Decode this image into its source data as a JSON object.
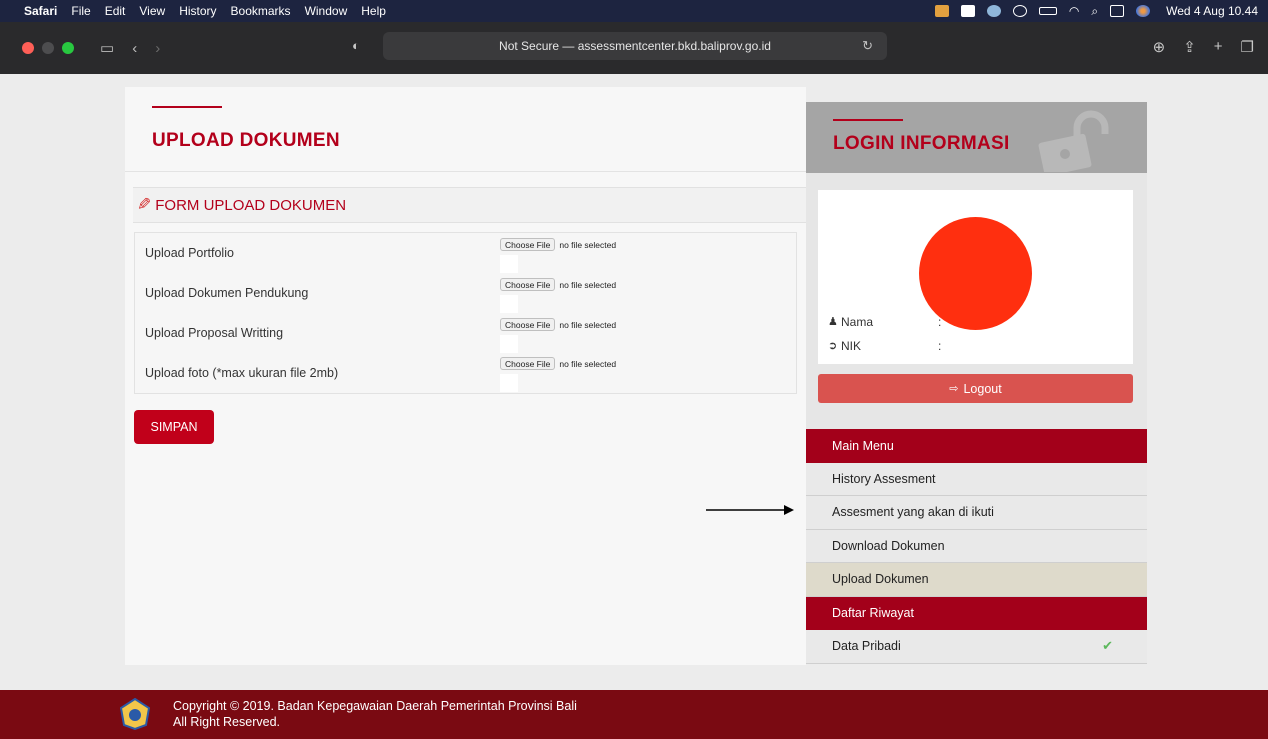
{
  "menubar": {
    "app": "Safari",
    "items": [
      "File",
      "Edit",
      "View",
      "History",
      "Bookmarks",
      "Window",
      "Help"
    ],
    "clock": "Wed 4 Aug  10.44"
  },
  "browser": {
    "url_text": "Not Secure — assessmentcenter.bkd.baliprov.go.id"
  },
  "main": {
    "page_title": "UPLOAD DOKUMEN",
    "form_title": "FORM UPLOAD DOKUMEN",
    "rows": [
      {
        "label": "Upload Portfolio",
        "button": "Choose File",
        "status": "no file selected"
      },
      {
        "label": "Upload Dokumen Pendukung",
        "button": "Choose File",
        "status": "no file selected"
      },
      {
        "label": "Upload Proposal Writting",
        "button": "Choose File",
        "status": "no file selected"
      },
      {
        "label": "Upload foto (*max ukuran file 2mb)",
        "button": "Choose File",
        "status": "no file selected"
      }
    ],
    "submit_label": "SIMPAN"
  },
  "sidebar": {
    "title": "LOGIN INFORMASI",
    "nama_label": "Nama",
    "nik_label": "NIK",
    "colon": ":",
    "logout_label": "Logout",
    "menu_header": "Main Menu",
    "menu": [
      "History Assesment",
      "Assesment yang akan di ikuti",
      "Download Dokumen",
      "Upload Dokumen"
    ],
    "section_header": "Daftar Riwayat",
    "section_items": [
      "Data Pribadi"
    ]
  },
  "footer": {
    "line1": "Copyright © 2019. Badan Kepegawaian Daerah Pemerintah Provinsi Bali",
    "line2": "All Right Reserved."
  },
  "colors": {
    "brand_red": "#b3001b",
    "menu_header": "#a3001a",
    "footer": "#7a0a12",
    "logout": "#d9534f",
    "avatar": "#ff2f0f",
    "active_menu": "#dedacb"
  },
  "icons": [
    "apple-icon",
    "sidebar-toggle-icon",
    "back-icon",
    "forward-icon",
    "shield-icon",
    "reload-icon",
    "download-icon",
    "share-icon",
    "new-tab-icon",
    "tabs-icon",
    "pencil-icon",
    "lock-icon",
    "user-icon",
    "id-icon",
    "logout-icon",
    "check-icon",
    "arrow-icon",
    "logo-icon"
  ]
}
